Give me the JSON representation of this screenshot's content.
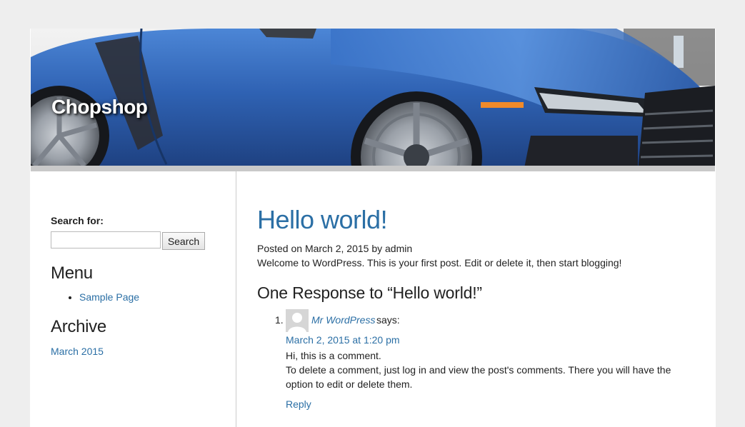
{
  "header": {
    "site_title": "Chopshop",
    "image": "blue-sports-car-banner"
  },
  "sidebar": {
    "search": {
      "label": "Search for:",
      "placeholder": "",
      "value": "",
      "button_label": "Search"
    },
    "menu": {
      "title": "Menu",
      "items": [
        {
          "label": "Sample Page"
        }
      ]
    },
    "archive": {
      "title": "Archive",
      "items": [
        {
          "label": "March 2015"
        }
      ]
    }
  },
  "post": {
    "title": "Hello world!",
    "meta": "Posted on March 2, 2015 by admin",
    "body": "Welcome to WordPress. This is your first post. Edit or delete it, then start blogging!"
  },
  "comments": {
    "title": "One Response to “Hello world!”",
    "items": [
      {
        "number": "1.",
        "author": "Mr WordPress",
        "says": "says:",
        "date": "March 2, 2015 at 1:20 pm",
        "lines": [
          "Hi, this is a comment.",
          "To delete a comment, just log in and view the post's comments. There you will have the option to edit or delete them."
        ],
        "reply_label": "Reply"
      }
    ]
  },
  "colors": {
    "link": "#2b6fa5",
    "page_bg": "#eeeeee",
    "content_bg": "#ffffff",
    "car_blue": "#2f62b3"
  },
  "icons": {
    "avatar": "default-user-avatar-icon"
  }
}
